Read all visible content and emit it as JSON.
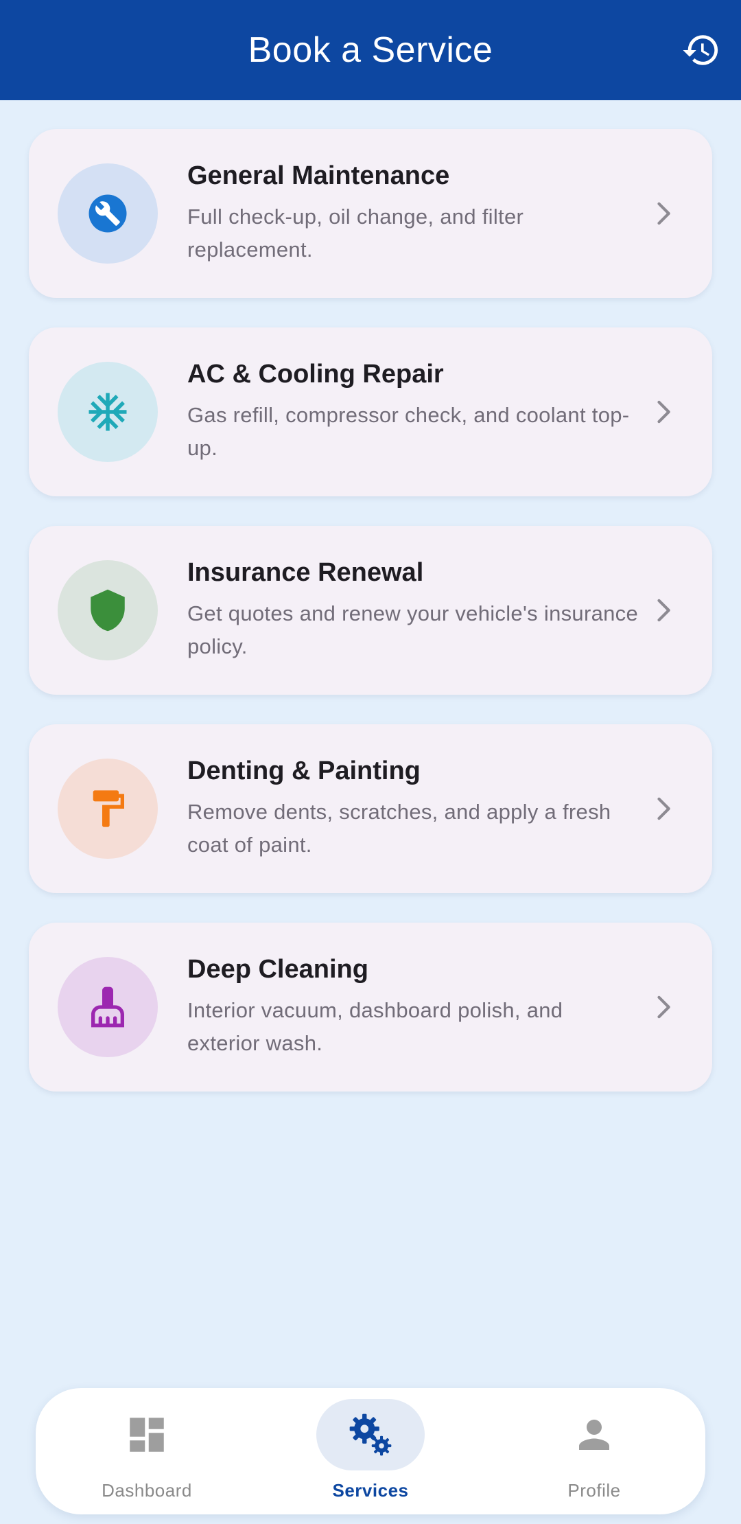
{
  "app_bar": {
    "title": "Book a Service",
    "history_icon": "history-icon",
    "background": "#0d47a1"
  },
  "services": [
    {
      "title": "General Maintenance",
      "description": "Full check-up, oil change, and filter replacement.",
      "icon": "wrench-icon",
      "icon_color": "#1976d2",
      "circle_color": "#d4e0f4"
    },
    {
      "title": "AC & Cooling Repair",
      "description": "Gas refill, compressor check, and coolant top-up.",
      "icon": "snowflake-icon",
      "icon_color": "#1fa9b8",
      "circle_color": "#d3e9f1"
    },
    {
      "title": "Insurance Renewal",
      "description": "Get quotes and renew your vehicle's insurance policy.",
      "icon": "shield-icon",
      "icon_color": "#3b8f3b",
      "circle_color": "#dbe4de"
    },
    {
      "title": "Denting & Painting",
      "description": "Remove dents, scratches, and apply a fresh coat of paint.",
      "icon": "paint-roller-icon",
      "icon_color": "#f47a12",
      "circle_color": "#f5ddd6"
    },
    {
      "title": "Deep Cleaning",
      "description": "Interior vacuum, dashboard polish, and exterior wash.",
      "icon": "cleaning-brush-icon",
      "icon_color": "#9c27b0",
      "circle_color": "#e8d3ee"
    }
  ],
  "bottom_nav": {
    "items": [
      {
        "label": "Dashboard",
        "icon": "dashboard-icon",
        "active": false
      },
      {
        "label": "Services",
        "icon": "gears-icon",
        "active": true
      },
      {
        "label": "Profile",
        "icon": "person-icon",
        "active": false
      }
    ],
    "active_color": "#0d47a1",
    "inactive_color": "#9e9e9e"
  }
}
